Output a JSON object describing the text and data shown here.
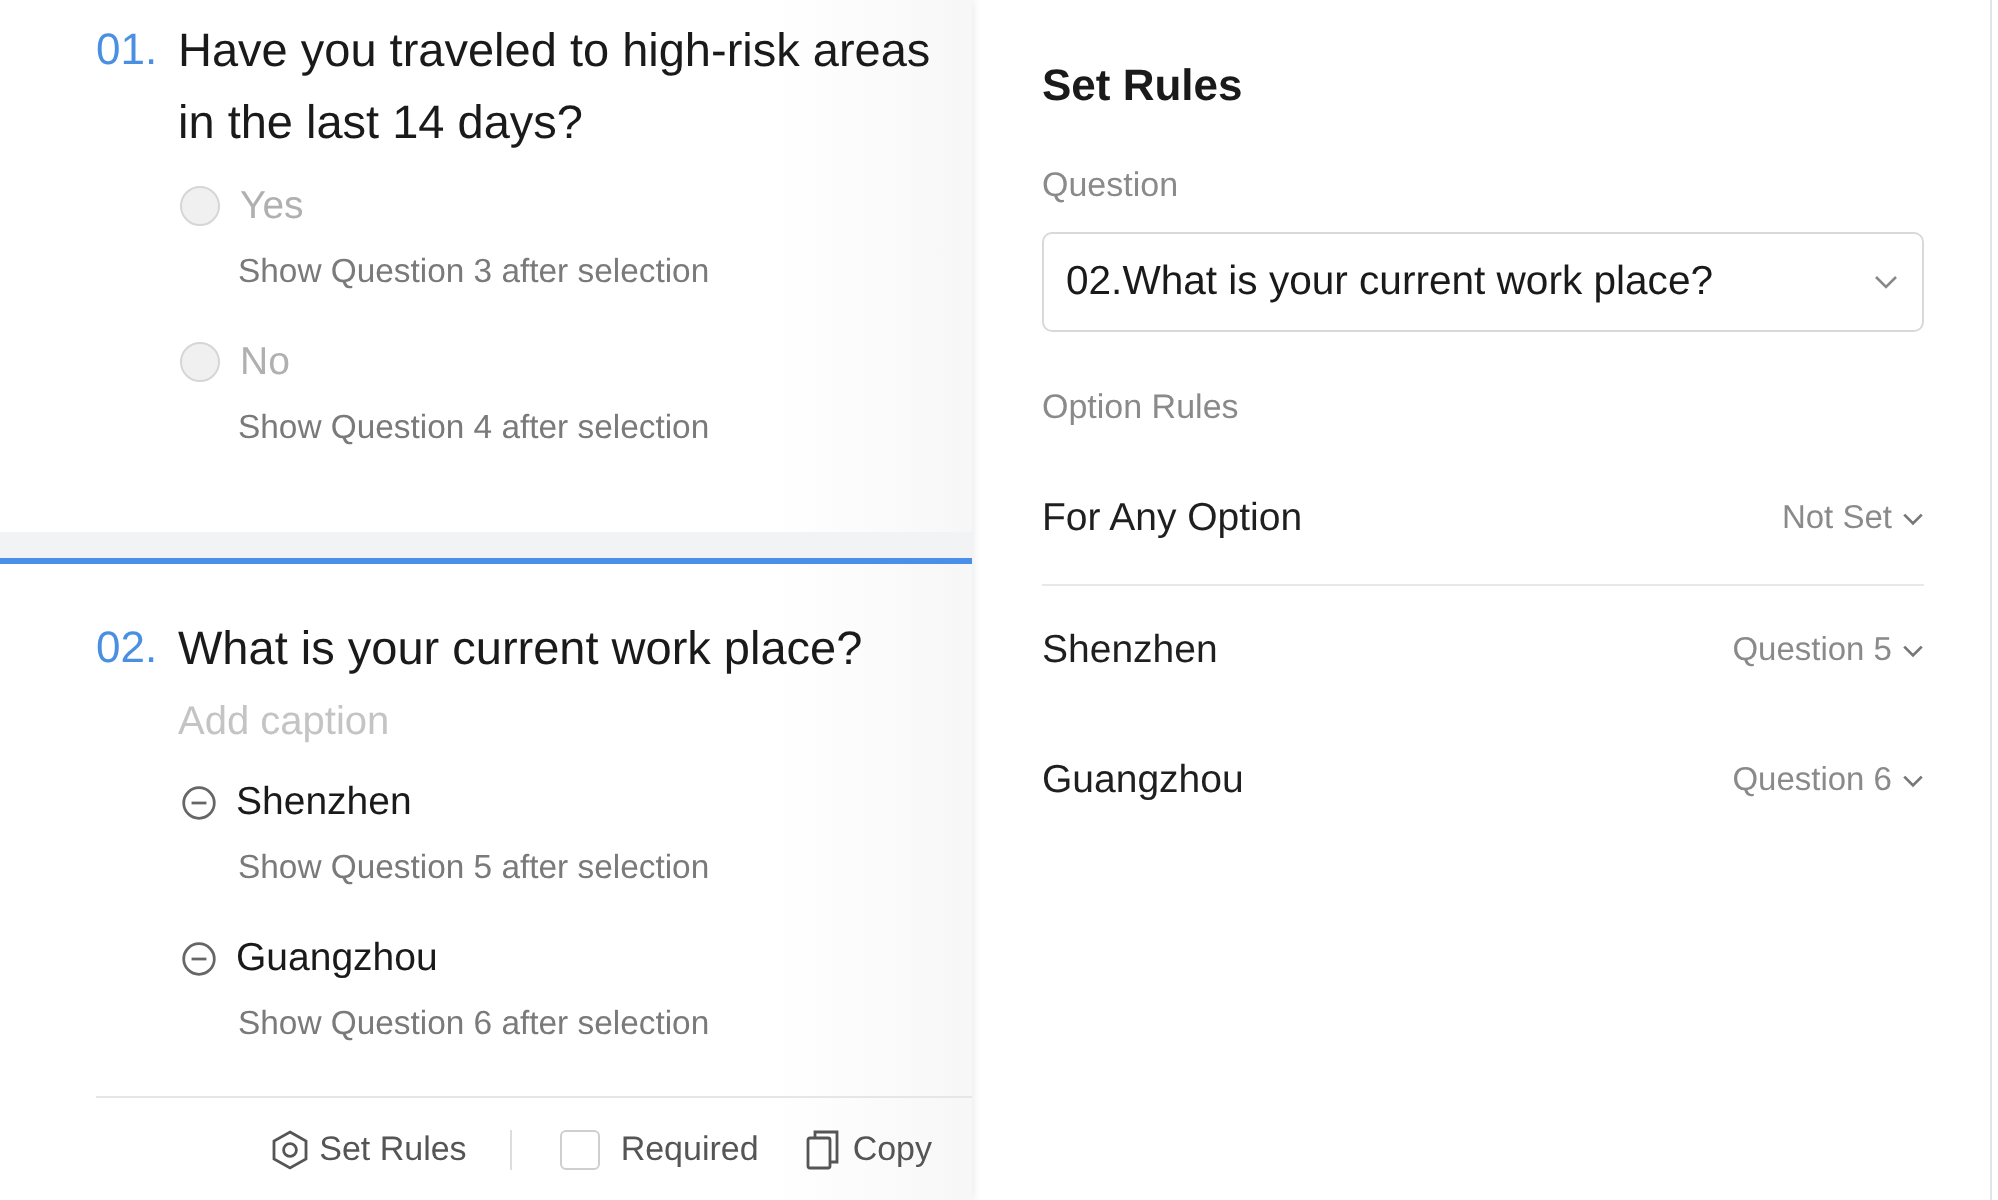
{
  "questions": [
    {
      "number": "01.",
      "title": "Have you traveled to high-risk areas in the last 14 days?",
      "selected": false,
      "options": [
        {
          "label": "Yes",
          "rule": "Show Question 3 after selection"
        },
        {
          "label": "No",
          "rule": "Show Question 4 after selection"
        }
      ]
    },
    {
      "number": "02.",
      "title": "What is your current work place?",
      "selected": true,
      "caption": {
        "placeholder": "Add caption"
      },
      "options": [
        {
          "label": "Shenzhen",
          "rule": "Show Question 5 after selection"
        },
        {
          "label": "Guangzhou",
          "rule": "Show Question 6 after selection"
        }
      ],
      "toolbar": {
        "set_rules": "Set Rules",
        "required": {
          "label": "Required",
          "checked": false
        },
        "copy": "Copy"
      }
    }
  ],
  "rules_panel": {
    "title": "Set Rules",
    "question_label": "Question",
    "question_select": {
      "value": "02.What is your current work place?"
    },
    "option_rules_label": "Option Rules",
    "rules": [
      {
        "kind": "any",
        "option": "For Any Option",
        "target": "Not Set"
      },
      {
        "kind": "option",
        "option": "Shenzhen",
        "target": "Question 5"
      },
      {
        "kind": "option",
        "option": "Guangzhou",
        "target": "Question 6"
      }
    ]
  }
}
